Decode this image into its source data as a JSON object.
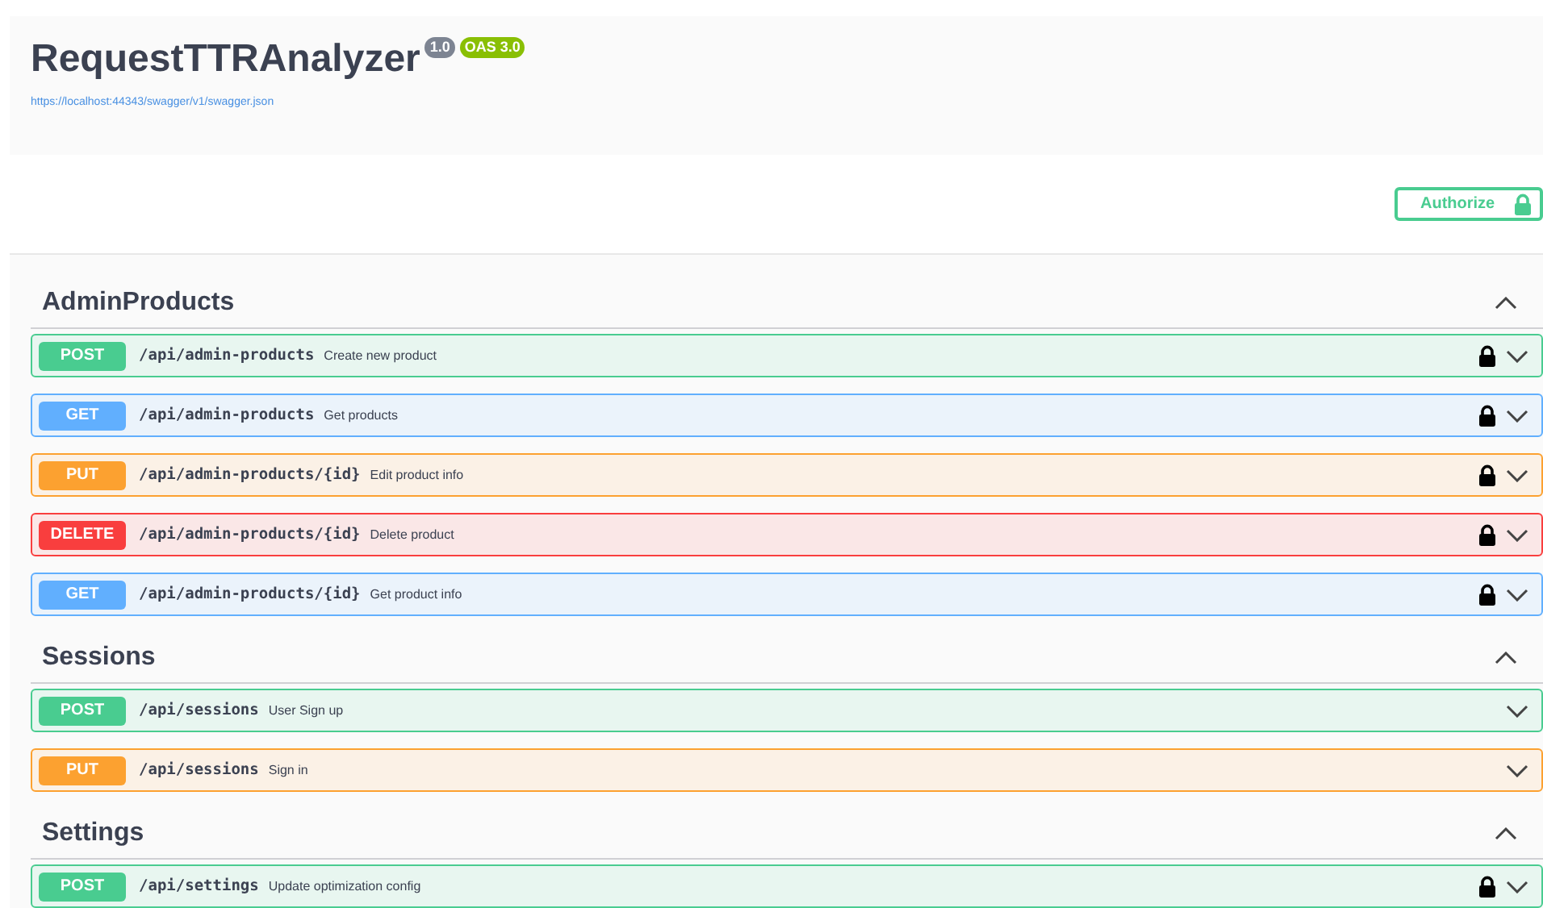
{
  "info": {
    "title": "RequestTTRAnalyzer",
    "version": "1.0",
    "oas": "OAS 3.0",
    "url": "https://localhost:44343/swagger/v1/swagger.json"
  },
  "authorize": {
    "label": "Authorize"
  },
  "sections": [
    {
      "name": "AdminProducts",
      "expanded": true,
      "operations": [
        {
          "method": "POST",
          "path": "/api/admin-products",
          "summary": "Create new product",
          "locked": true,
          "expanded": false
        },
        {
          "method": "GET",
          "path": "/api/admin-products",
          "summary": "Get products",
          "locked": true,
          "expanded": false
        },
        {
          "method": "PUT",
          "path": "/api/admin-products/{id}",
          "summary": "Edit product info",
          "locked": true,
          "expanded": false
        },
        {
          "method": "DELETE",
          "path": "/api/admin-products/{id}",
          "summary": "Delete product",
          "locked": true,
          "expanded": false
        },
        {
          "method": "GET",
          "path": "/api/admin-products/{id}",
          "summary": "Get product info",
          "locked": true,
          "expanded": false
        }
      ]
    },
    {
      "name": "Sessions",
      "expanded": true,
      "operations": [
        {
          "method": "POST",
          "path": "/api/sessions",
          "summary": "User Sign up",
          "locked": false,
          "expanded": false
        },
        {
          "method": "PUT",
          "path": "/api/sessions",
          "summary": "Sign in",
          "locked": false,
          "expanded": false
        }
      ]
    },
    {
      "name": "Settings",
      "expanded": true,
      "operations": [
        {
          "method": "POST",
          "path": "/api/settings",
          "summary": "Update optimization config",
          "locked": true,
          "expanded": false
        }
      ]
    }
  ]
}
